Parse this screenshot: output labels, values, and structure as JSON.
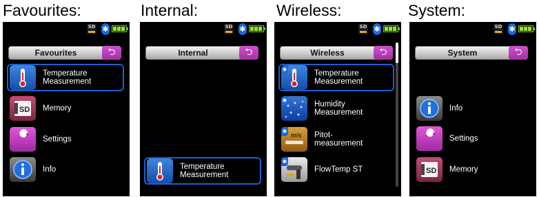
{
  "status": {
    "sd_label": "SD",
    "bluetooth_glyph": "✱"
  },
  "icons": {
    "thermometer": "thermometer-icon",
    "memory": "sd-card-icon",
    "settings": "wrench-icon",
    "info": "info-icon",
    "humidity": "humidity-icon",
    "pitot": "pitot-tube-icon",
    "flow": "flow-sensor-icon",
    "back": "back-arrow-icon",
    "bluetooth": "bluetooth-icon",
    "battery": "battery-icon"
  },
  "colors": {
    "selection": "#1a5fd0",
    "back_button": "#b83ab6",
    "battery": "#9be22c"
  },
  "panels": [
    {
      "caption": "Favourites:",
      "header": "Favourites",
      "items": [
        {
          "label": "Temperature\nMeasurement"
        },
        {
          "label": "Memory"
        },
        {
          "label": "Settings"
        },
        {
          "label": "Info"
        }
      ]
    },
    {
      "caption": "Internal:",
      "header": "Internal",
      "items": [
        {
          "label": "Temperature\nMeasurement"
        }
      ]
    },
    {
      "caption": "Wireless:",
      "header": "Wireless",
      "items": [
        {
          "label": "Temperature\nMeasurement"
        },
        {
          "label": "Humidity\nMeasurement"
        },
        {
          "label": "Pitot-\nmeasurement"
        },
        {
          "label": "FlowTemp ST"
        }
      ]
    },
    {
      "caption": "System:",
      "header": "System",
      "items": [
        {
          "label": "Info"
        },
        {
          "label": "Settings"
        },
        {
          "label": "Memory"
        }
      ]
    }
  ]
}
